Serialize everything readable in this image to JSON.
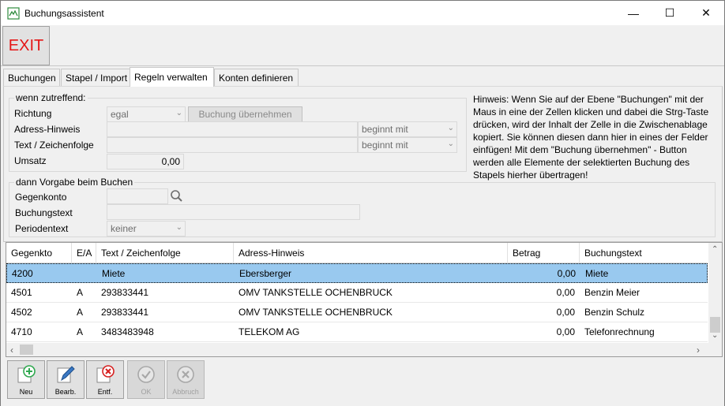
{
  "window": {
    "title": "Buchungsassistent",
    "minimize": "—",
    "maximize": "☐",
    "close": "✕"
  },
  "toolbar": {
    "exit_label": "EXIT"
  },
  "tabs": [
    {
      "label": "Buchungen"
    },
    {
      "label": "Stapel / Import"
    },
    {
      "label": "Regeln verwalten"
    },
    {
      "label": "Konten definieren"
    }
  ],
  "conditions": {
    "legend": "wenn zutreffend:",
    "richtung_label": "Richtung",
    "richtung_value": "egal",
    "apply_button": "Buchung übernehmen",
    "adress_label": "Adress-Hinweis",
    "adress_match": "beginnt mit",
    "text_label": "Text / Zeichenfolge",
    "text_match": "beginnt mit",
    "umsatz_label": "Umsatz",
    "umsatz_value": "0,00"
  },
  "defaults": {
    "legend": "dann Vorgabe beim Buchen",
    "gegenkonto_label": "Gegenkonto",
    "buchungstext_label": "Buchungstext",
    "periodentext_label": "Periodentext",
    "periodentext_value": "keiner"
  },
  "hint": "Hinweis: Wenn Sie auf der Ebene \"Buchungen\" mit der Maus in eine der Zellen klicken und dabei die Strg-Taste drücken, wird der Inhalt der Zelle in die Zwischenablage kopiert. Sie können diesen dann hier in eines der Felder einfügen! Mit dem \"Buchung übernehmen\" - Button werden alle Elemente der selektierten Buchung des Stapels hierher übertragen!",
  "table": {
    "columns": [
      "Gegenkto",
      "E/A",
      "Text / Zeichenfolge",
      "Adress-Hinweis",
      "Betrag",
      "Buchungstext"
    ],
    "rows": [
      {
        "gegenkto": "4200",
        "ea": "",
        "text": "Miete",
        "adresse": "Ebersberger",
        "betrag": "0,00",
        "buchungstext": "Miete"
      },
      {
        "gegenkto": "4501",
        "ea": "A",
        "text": "293833441",
        "adresse": "OMV TANKSTELLE OCHENBRUCK",
        "betrag": "0,00",
        "buchungstext": "Benzin Meier"
      },
      {
        "gegenkto": "4502",
        "ea": "A",
        "text": "293833441",
        "adresse": "OMV TANKSTELLE OCHENBRUCK",
        "betrag": "0,00",
        "buchungstext": "Benzin Schulz"
      },
      {
        "gegenkto": "4710",
        "ea": "A",
        "text": "3483483948",
        "adresse": "TELEKOM AG",
        "betrag": "0,00",
        "buchungstext": "Telefonrechnung"
      }
    ]
  },
  "actions": {
    "new": "Neu",
    "edit": "Bearb.",
    "delete": "Entf.",
    "ok": "OK",
    "cancel": "Abbruch"
  },
  "colors": {
    "exit_text": "#e51515",
    "selected_row": "#99c9ef"
  }
}
